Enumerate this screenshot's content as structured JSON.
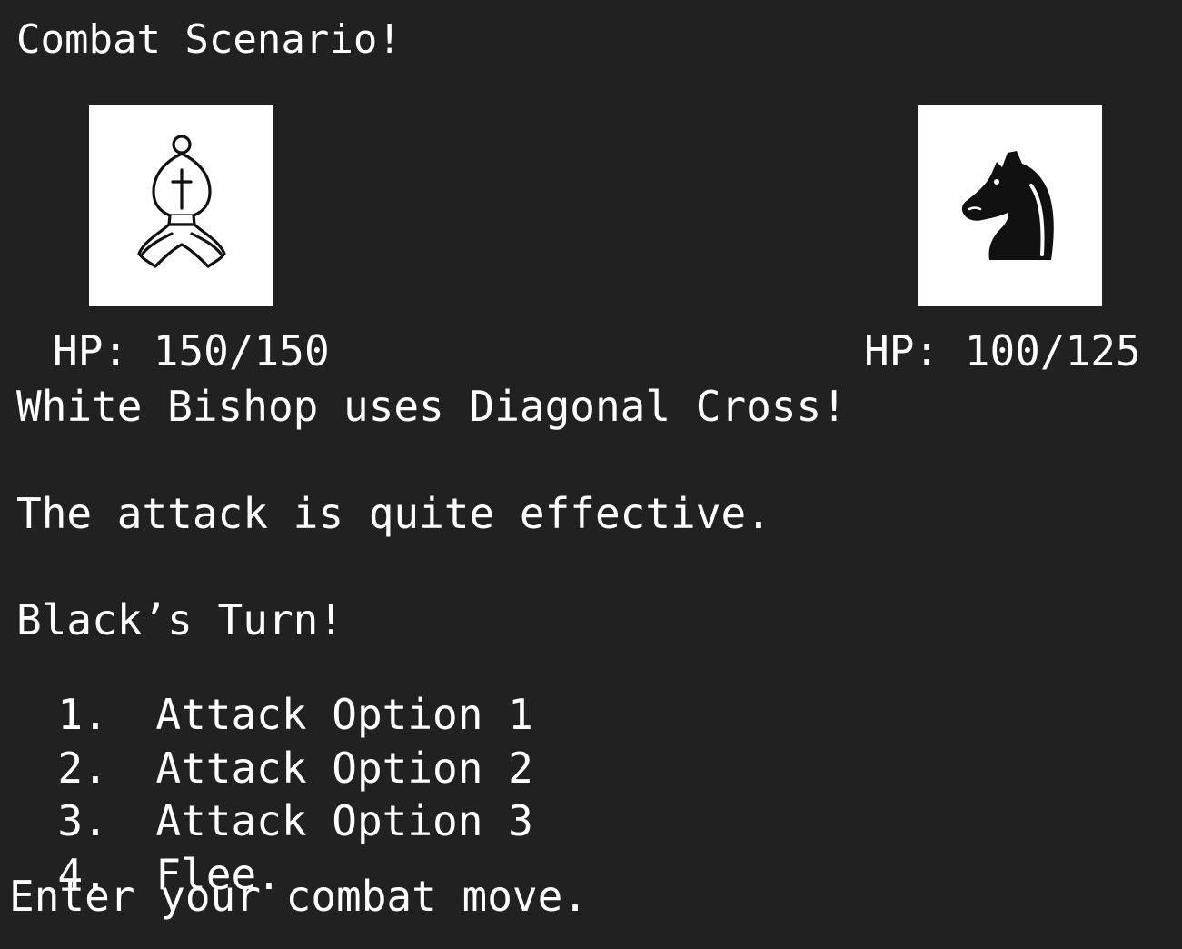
{
  "title": "Combat Scenario!",
  "player": {
    "piece_icon": "white-bishop-icon",
    "hp_text": "HP: 150/150"
  },
  "enemy": {
    "piece_icon": "black-knight-icon",
    "hp_text": "HP: 100/125"
  },
  "log": [
    "White Bishop uses Diagonal Cross!",
    "The attack is quite effective."
  ],
  "turn_text": "Black’s Turn!",
  "options": [
    {
      "number": "1.",
      "label": "Attack Option 1"
    },
    {
      "number": "2.",
      "label": "Attack Option 2"
    },
    {
      "number": "3.",
      "label": "Attack Option 3"
    },
    {
      "number": "4.",
      "label": "Flee."
    }
  ],
  "prompt": "Enter your combat move.",
  "colors": {
    "background": "#212121",
    "text": "#ffffff",
    "portrait_bg": "#ffffff"
  }
}
